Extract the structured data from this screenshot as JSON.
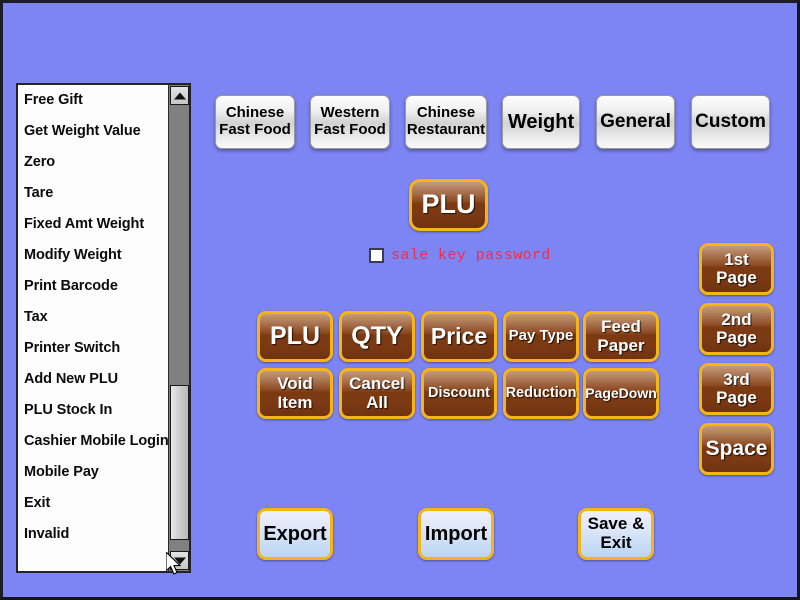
{
  "window": {
    "background_color": "#7d84f3",
    "accent_gold": "#f5b519",
    "button_brown": "#7d3a12"
  },
  "function_list": {
    "name": "function-key-list",
    "items": [
      {
        "label": "Free Gift"
      },
      {
        "label": "Get Weight Value"
      },
      {
        "label": "Zero"
      },
      {
        "label": "Tare"
      },
      {
        "label": "Fixed Amt Weight"
      },
      {
        "label": "Modify Weight"
      },
      {
        "label": "Print Barcode"
      },
      {
        "label": "Tax"
      },
      {
        "label": "Printer Switch"
      },
      {
        "label": "Add New PLU"
      },
      {
        "label": "PLU Stock In"
      },
      {
        "label": "Cashier Mobile Login"
      },
      {
        "label": "Mobile Pay"
      },
      {
        "label": "Exit"
      },
      {
        "label": "Invalid"
      }
    ],
    "scrollbar": {
      "up_arrow": "scroll-up-arrow-icon",
      "down_arrow": "scroll-down-arrow-icon"
    }
  },
  "categories": [
    {
      "line1": "Chinese",
      "line2": "Fast Food"
    },
    {
      "line1": "Western",
      "line2": "Fast Food"
    },
    {
      "line1": "Chinese",
      "line2": "Restaurant"
    },
    {
      "line1": "Weight",
      "line2": ""
    },
    {
      "line1": "General",
      "line2": ""
    },
    {
      "line1": "Custom",
      "line2": ""
    }
  ],
  "selected_key": {
    "label": "PLU"
  },
  "sale_key_password": {
    "label": "sale key password",
    "checked": false,
    "color": "#e8314f"
  },
  "keypad": {
    "row1": [
      {
        "line1": "PLU",
        "line2": ""
      },
      {
        "line1": "QTY",
        "line2": ""
      },
      {
        "line1": "Price",
        "line2": ""
      },
      {
        "line1": "Pay Type",
        "line2": ""
      },
      {
        "line1": "Feed",
        "line2": "Paper"
      }
    ],
    "row2": [
      {
        "line1": "Void",
        "line2": "Item"
      },
      {
        "line1": "Cancel",
        "line2": "All"
      },
      {
        "line1": "Discount",
        "line2": ""
      },
      {
        "line1": "Reduction",
        "line2": ""
      },
      {
        "line1": "PageDown",
        "line2": ""
      }
    ]
  },
  "pages": [
    {
      "label": "1st Page"
    },
    {
      "label": "2nd Page"
    },
    {
      "label": "3rd Page"
    },
    {
      "label": "Space"
    }
  ],
  "actions": [
    {
      "line1": "Export",
      "line2": ""
    },
    {
      "line1": "Import",
      "line2": ""
    },
    {
      "line1": "Save &",
      "line2": "Exit"
    }
  ]
}
